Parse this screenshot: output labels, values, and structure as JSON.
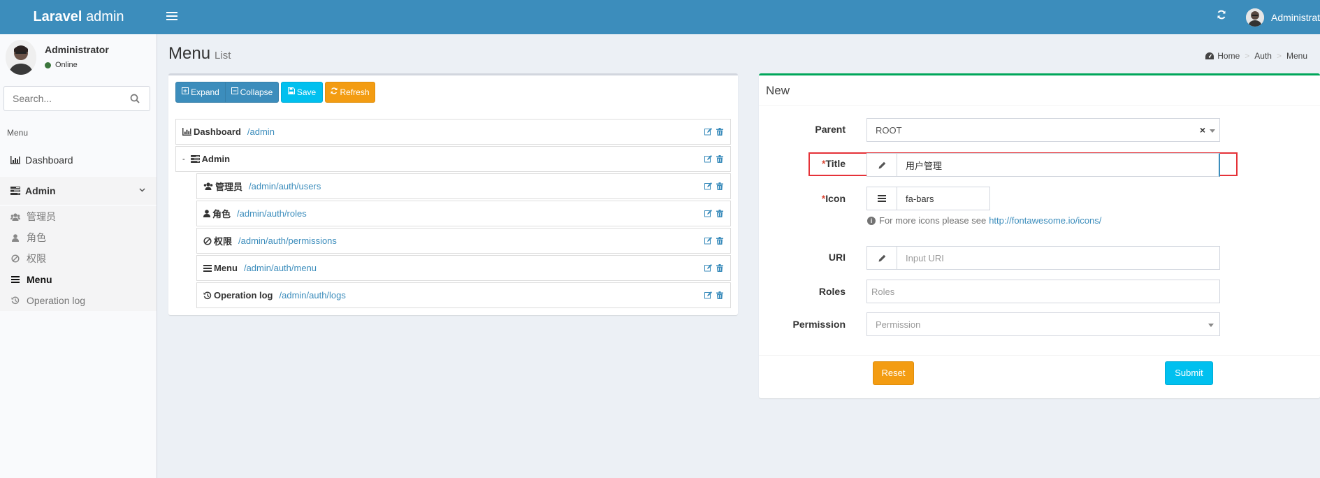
{
  "header": {
    "logo_bold": "Laravel",
    "logo_light": "admin",
    "user_name": "Administrator"
  },
  "sidebar": {
    "user": {
      "name": "Administrator",
      "status": "Online"
    },
    "search_placeholder": "Search...",
    "menu_header": "Menu",
    "items": [
      {
        "label": "Dashboard",
        "icon": "bar-chart-icon"
      },
      {
        "label": "Admin",
        "icon": "tasks-icon"
      }
    ],
    "sub_items": [
      {
        "label": "管理员",
        "icon": "users-icon"
      },
      {
        "label": "角色",
        "icon": "user-icon"
      },
      {
        "label": "权限",
        "icon": "ban-icon"
      },
      {
        "label": "Menu",
        "icon": "bars-icon",
        "active": true
      },
      {
        "label": "Operation log",
        "icon": "history-icon"
      }
    ]
  },
  "content": {
    "title": "Menu",
    "subtitle": "List",
    "breadcrumb": [
      "Home",
      "Auth",
      "Menu"
    ]
  },
  "toolbar": {
    "expand": "Expand",
    "collapse": "Collapse",
    "save": "Save",
    "refresh": "Refresh"
  },
  "tree": [
    {
      "title": "Dashboard",
      "uri": "/admin",
      "icon": "bar-chart-icon"
    },
    {
      "title": "Admin",
      "uri": "",
      "icon": "tasks-icon"
    },
    {
      "title": "管理员",
      "uri": "/admin/auth/users",
      "icon": "users-icon"
    },
    {
      "title": "角色",
      "uri": "/admin/auth/roles",
      "icon": "user-icon"
    },
    {
      "title": "权限",
      "uri": "/admin/auth/permissions",
      "icon": "ban-icon"
    },
    {
      "title": "Menu",
      "uri": "/admin/auth/menu",
      "icon": "bars-icon"
    },
    {
      "title": "Operation log",
      "uri": "/admin/auth/logs",
      "icon": "history-icon"
    }
  ],
  "form": {
    "box_title": "New",
    "labels": {
      "parent": "Parent",
      "title": "Title",
      "icon": "Icon",
      "uri": "URI",
      "roles": "Roles",
      "permission": "Permission"
    },
    "required_mark": "*",
    "parent_value": "ROOT",
    "parent_clear": "×",
    "title_value": "用户管理",
    "icon_value": "fa-bars",
    "icon_help": "For more icons please see",
    "icon_help_link": "http://fontawesome.io/icons/",
    "uri_placeholder": "Input URI",
    "roles_placeholder": "Roles",
    "permission_placeholder": "Permission",
    "reset": "Reset",
    "submit": "Submit"
  }
}
